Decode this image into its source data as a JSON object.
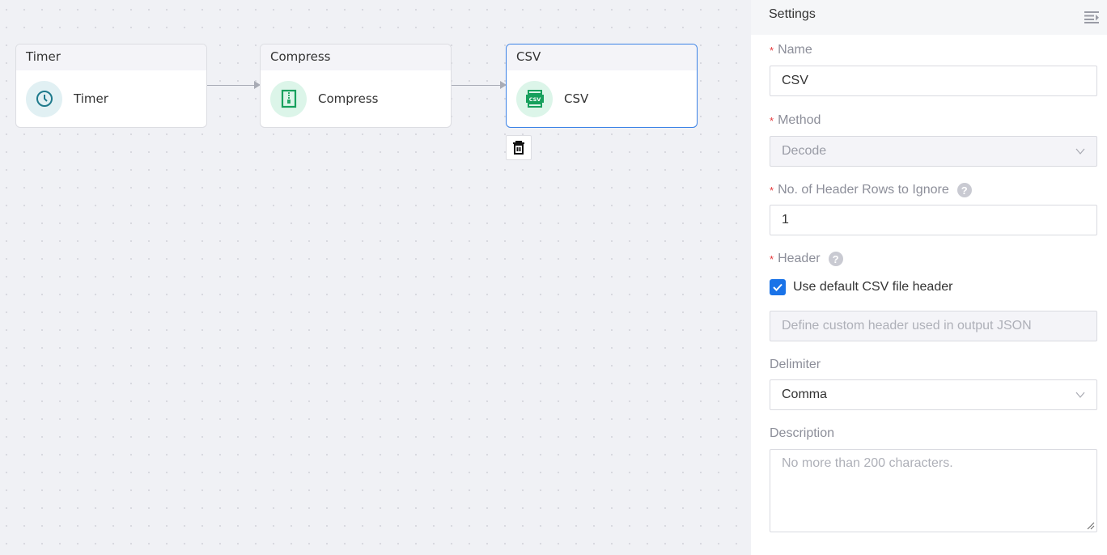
{
  "canvas": {
    "nodes": [
      {
        "header": "Timer",
        "label": "Timer",
        "icon": "clock-icon",
        "selected": false
      },
      {
        "header": "Compress",
        "label": "Compress",
        "icon": "compress-icon",
        "selected": false
      },
      {
        "header": "CSV",
        "label": "CSV",
        "icon": "csv-icon",
        "icon_text": "CSV",
        "selected": true
      }
    ],
    "delete_button": {
      "icon": "trash-icon"
    }
  },
  "settings": {
    "title": "Settings",
    "toggle_icon": "collapse-panel-icon",
    "fields": {
      "name": {
        "label": "Name",
        "required": "*",
        "value": "CSV"
      },
      "method": {
        "label": "Method",
        "required": "*",
        "value": "Decode",
        "disabled": true
      },
      "header_rows": {
        "label": "No. of Header Rows to Ignore",
        "required": "*",
        "value": "1",
        "help": "?"
      },
      "header": {
        "label": "Header",
        "required": "*",
        "help": "?",
        "checkbox_label": "Use default CSV file header",
        "checked": true,
        "custom_placeholder": "Define custom header used in output JSON"
      },
      "delimiter": {
        "label": "Delimiter",
        "value": "Comma"
      },
      "description": {
        "label": "Description",
        "placeholder": "No more than 200 characters."
      }
    }
  },
  "colors": {
    "accent": "#1a73e8",
    "selected_border": "#3b82e6",
    "required": "#e5383b",
    "timer_icon": "#1e7a8c",
    "compress_icon": "#17a05d"
  }
}
